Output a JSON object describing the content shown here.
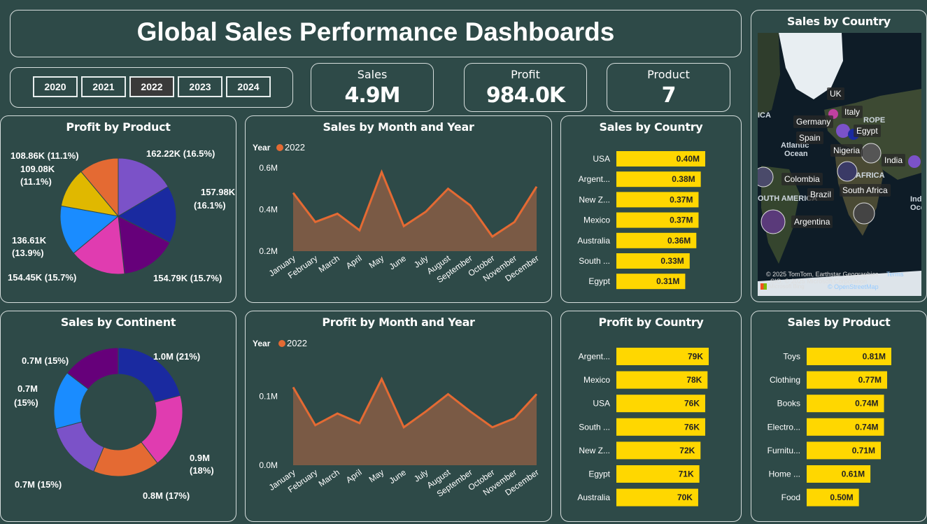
{
  "title": "Global Sales Performance Dashboards",
  "years": [
    "2020",
    "2021",
    "2022",
    "2023",
    "2024"
  ],
  "selected_year": "2022",
  "kpis": {
    "sales": {
      "label": "Sales",
      "value": "4.9M"
    },
    "profit": {
      "label": "Profit",
      "value": "984.0K"
    },
    "product": {
      "label": "Product",
      "value": "7"
    }
  },
  "colors": {
    "background": "#2e4a48",
    "bar": "#ffd700",
    "area_fill": "#7a5a45",
    "area_line": "#e46a33",
    "pie": [
      "#7b52c8",
      "#1a2aa0",
      "#66007a",
      "#e03cb0",
      "#1a8cff",
      "#e0b800",
      "#e46a33"
    ]
  },
  "profit_by_product": {
    "title": "Profit by Product",
    "labels": [
      "162.22K (16.5%)",
      "157.98K",
      "(16.1%)",
      "154.79K (15.7%)",
      "154.45K (15.7%)",
      "136.61K",
      "(13.9%)",
      "108.86K (11.1%)",
      "109.08K",
      "(11.1%)"
    ]
  },
  "sales_by_continent": {
    "title": "Sales by Continent",
    "labels": [
      "1.0M (21%)",
      "0.9M",
      "(18%)",
      "0.8M (17%)",
      "0.7M (15%)",
      "0.7M",
      "(15%)",
      "0.7M (15%)"
    ]
  },
  "map": {
    "title": "Sales by Country",
    "labels": [
      "UK",
      "Italy",
      "Germany",
      "Spain",
      "Egypt",
      "Nigeria",
      "India",
      "Colombia",
      "Brazil",
      "South Africa",
      "Argentina"
    ],
    "region_text": [
      "ICA",
      "Atlantic",
      "Ocean",
      "ROPE",
      "AFRICA",
      "OUTH AMERICA",
      "Ind",
      "Oce"
    ],
    "attribution": [
      "© 2025 TomTom, Earthstar Geographics",
      "Terms",
      "SIO, © 2025 Microsoft Corporation",
      "Microsoft Bing",
      "© OpenStreetMap"
    ]
  },
  "chart_data": [
    {
      "type": "pie",
      "title": "Profit by Product",
      "values": [
        162.22,
        157.98,
        154.79,
        154.45,
        136.61,
        109.08,
        108.86
      ],
      "percentages": [
        16.5,
        16.1,
        15.7,
        15.7,
        13.9,
        11.1,
        11.1
      ],
      "unit": "K"
    },
    {
      "type": "area",
      "title": "Sales by Month and Year",
      "legend_title": "Year",
      "series": [
        {
          "name": "2022",
          "values": [
            0.48,
            0.34,
            0.38,
            0.3,
            0.58,
            0.32,
            0.39,
            0.5,
            0.42,
            0.27,
            0.34,
            0.51
          ]
        }
      ],
      "categories": [
        "January",
        "February",
        "March",
        "April",
        "May",
        "June",
        "July",
        "August",
        "September",
        "October",
        "November",
        "December"
      ],
      "yticks": [
        "0.2M",
        "0.4M",
        "0.6M"
      ],
      "ylim": [
        0.2,
        0.62
      ]
    },
    {
      "type": "bar",
      "title": "Sales by Country",
      "categories": [
        "USA",
        "Argent...",
        "New Z...",
        "Mexico",
        "Australia",
        "South ...",
        "Egypt"
      ],
      "values": [
        0.4,
        0.38,
        0.37,
        0.37,
        0.36,
        0.33,
        0.31
      ],
      "labels": [
        "0.40M",
        "0.38M",
        "0.37M",
        "0.37M",
        "0.36M",
        "0.33M",
        "0.31M"
      ]
    },
    {
      "type": "pie",
      "title": "Sales by Continent",
      "values": [
        1.0,
        0.9,
        0.8,
        0.7,
        0.7,
        0.7
      ],
      "percentages": [
        21,
        18,
        17,
        15,
        15,
        15
      ],
      "unit": "M"
    },
    {
      "type": "area",
      "title": "Profit by Month and Year",
      "legend_title": "Year",
      "series": [
        {
          "name": "2022",
          "values": [
            0.113,
            0.058,
            0.075,
            0.061,
            0.125,
            0.055,
            0.078,
            0.103,
            0.078,
            0.055,
            0.068,
            0.103
          ]
        }
      ],
      "categories": [
        "January",
        "February",
        "March",
        "April",
        "May",
        "June",
        "July",
        "August",
        "September",
        "October",
        "November",
        "December"
      ],
      "yticks": [
        "0.0M",
        "0.1M"
      ],
      "ylim": [
        0,
        0.15
      ]
    },
    {
      "type": "bar",
      "title": "Profit by Country",
      "categories": [
        "Argent...",
        "Mexico",
        "USA",
        "South ...",
        "New Z...",
        "Egypt",
        "Australia"
      ],
      "values": [
        79,
        78,
        76,
        76,
        72,
        71,
        70
      ],
      "labels": [
        "79K",
        "78K",
        "76K",
        "76K",
        "72K",
        "71K",
        "70K"
      ]
    },
    {
      "type": "bar",
      "title": "Sales by Product",
      "categories": [
        "Toys",
        "Clothing",
        "Books",
        "Electro...",
        "Furnitu...",
        "Home ...",
        "Food"
      ],
      "values": [
        0.81,
        0.77,
        0.74,
        0.74,
        0.71,
        0.61,
        0.5
      ],
      "labels": [
        "0.81M",
        "0.77M",
        "0.74M",
        "0.74M",
        "0.71M",
        "0.61M",
        "0.50M"
      ]
    }
  ]
}
